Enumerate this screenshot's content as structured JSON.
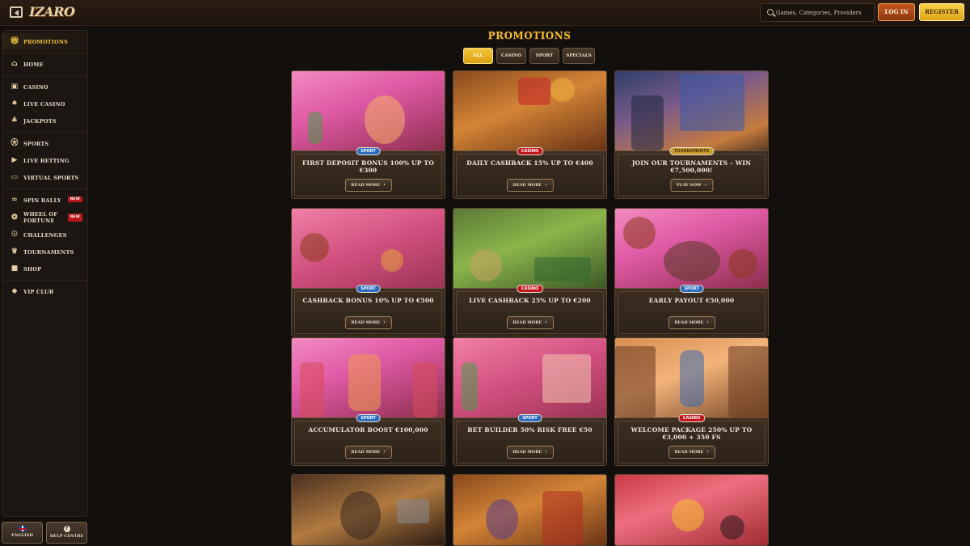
{
  "header": {
    "logo": "IZARO",
    "search_placeholder": "Games, Categories, Providers",
    "login_label": "LOG IN",
    "register_label": "REGISTER"
  },
  "sidebar": {
    "items": [
      {
        "label": "PROMOTIONS",
        "icon": "gift-icon",
        "active": true
      },
      {
        "label": "HOME",
        "icon": "home-icon"
      },
      {
        "label": "CASINO",
        "icon": "slot-icon"
      },
      {
        "label": "LIVE CASINO",
        "icon": "cards-icon"
      },
      {
        "label": "JACKPOTS",
        "icon": "jackpot-icon"
      },
      {
        "label": "SPORTS",
        "icon": "ball-icon"
      },
      {
        "label": "LIVE BETTING",
        "icon": "play-icon"
      },
      {
        "label": "VIRTUAL SPORTS",
        "icon": "monitor-icon"
      },
      {
        "label": "SPIN RALLY",
        "icon": "rally-icon",
        "badge": "NEW"
      },
      {
        "label": "WHEEL OF FORTUNE",
        "icon": "wheel-icon",
        "badge": "NEW"
      },
      {
        "label": "CHALLENGES",
        "icon": "medal-icon"
      },
      {
        "label": "TOURNAMENTS",
        "icon": "trophy-icon"
      },
      {
        "label": "SHOP",
        "icon": "bag-icon"
      },
      {
        "label": "VIP CLUB",
        "icon": "diamond-icon"
      }
    ],
    "language_label": "ENGLISH",
    "help_label": "HELP CENTRE"
  },
  "main": {
    "title": "PROMOTIONS",
    "filters": [
      "ALL",
      "CASINO",
      "SPORT",
      "SPECIALS"
    ],
    "active_filter": "ALL",
    "cards": [
      {
        "title": "FIRST DEPOSIT BONUS 100% UP TO €300",
        "tag": "SPORT",
        "button": "READ MORE"
      },
      {
        "title": "DAILY CASHBACK 15% UP TO €400",
        "tag": "CASINO",
        "button": "READ MORE"
      },
      {
        "title": "JOIN OUR TOURNAMENTS – WIN €7,500,000!",
        "tag": "TOURNAMENTS",
        "button": "PLAY NOW"
      },
      {
        "title": "CASHBACK BONUS 10% UP TO €500",
        "tag": "SPORT",
        "button": "READ MORE"
      },
      {
        "title": "LIVE CASHBACK 25% UP TO €200",
        "tag": "CASINO",
        "button": "READ MORE"
      },
      {
        "title": "EARLY PAYOUT €50,000",
        "tag": "SPORT",
        "button": "READ MORE"
      },
      {
        "title": "ACCUMULATOR BOOST €100,000",
        "tag": "SPORT",
        "button": "READ MORE"
      },
      {
        "title": "BET BUILDER 50% RISK FREE €50",
        "tag": "SPORT",
        "button": "READ MORE"
      },
      {
        "title": "WELCOME PACKAGE 250% UP TO €3,000 + 350 FS",
        "tag": "CASINO",
        "button": "READ MORE"
      }
    ]
  },
  "colors": {
    "accent_gold": "#f0bd2b",
    "sport_tag": "#2d6cbf",
    "casino_tag": "#c2161d",
    "new_badge": "#b8181c"
  }
}
